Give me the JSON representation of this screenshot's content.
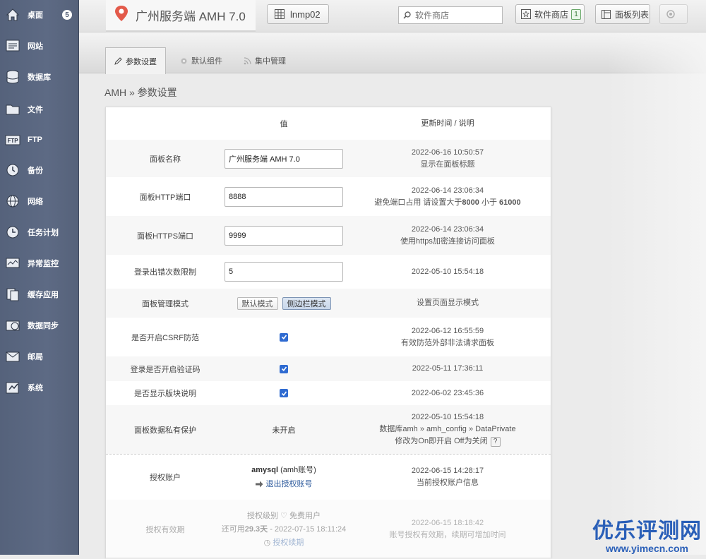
{
  "sidebar": {
    "items": [
      {
        "label": "桌面",
        "badge": "5",
        "icon": "home-icon"
      },
      {
        "label": "网站",
        "icon": "website-icon"
      },
      {
        "label": "数据库",
        "icon": "database-icon"
      },
      {
        "label": "文件",
        "icon": "folder-icon"
      },
      {
        "label": "FTP",
        "icon": "ftp-icon"
      },
      {
        "label": "备份",
        "icon": "backup-icon"
      },
      {
        "label": "网络",
        "icon": "globe-icon"
      },
      {
        "label": "任务计划",
        "icon": "clock-icon"
      },
      {
        "label": "异常监控",
        "icon": "monitor-icon"
      },
      {
        "label": "缓存应用",
        "icon": "cache-icon"
      },
      {
        "label": "数据同步",
        "icon": "sync-icon"
      },
      {
        "label": "邮局",
        "icon": "mail-icon"
      },
      {
        "label": "系统",
        "icon": "system-icon"
      }
    ]
  },
  "header": {
    "title": "广州服务端 AMH 7.0",
    "env_label": "lnmp02",
    "search_placeholder": "软件商店",
    "store_label": "软件商店",
    "store_count": "1",
    "panel_list_label": "面板列表"
  },
  "tabs": [
    {
      "label": "参数设置",
      "active": true
    },
    {
      "label": "默认组件",
      "active": false
    },
    {
      "label": "集中管理",
      "active": false
    }
  ],
  "breadcrumb": "AMH » 参数设置",
  "table": {
    "headers": {
      "value": "值",
      "updated": "更新时间 / 说明"
    },
    "rows": {
      "panel_name": {
        "label": "面板名称",
        "value": "广州服务端 AMH 7.0",
        "time": "2022-06-16 10:50:57",
        "note": "显示在面板标题"
      },
      "http_port": {
        "label": "面板HTTP端口",
        "value": "8888",
        "time": "2022-06-14 23:06:34",
        "note_pre": "避免端口占用 请设置大于",
        "note_min": "8000",
        "note_mid": " 小于",
        "note_max": "61000"
      },
      "https_port": {
        "label": "面板HTTPS端口",
        "value": "9999",
        "time": "2022-06-14 23:06:34",
        "note": "使用https加密连接访问面板"
      },
      "login_limit": {
        "label": "登录出错次数限制",
        "value": "5",
        "time": "2022-05-10 15:54:18"
      },
      "panel_mode": {
        "label": "面板管理模式",
        "btn_default": "默认模式",
        "btn_sidebar": "侧边栏模式",
        "note": "设置页面显示模式"
      },
      "csrf": {
        "label": "是否开启CSRF防范",
        "checked": true,
        "time": "2022-06-12 16:55:59",
        "note": "有效防范外部非法请求面板"
      },
      "captcha": {
        "label": "登录是否开启验证码",
        "checked": true,
        "time": "2022-05-11 17:36:11"
      },
      "block_desc": {
        "label": "是否显示版块说明",
        "checked": true,
        "time": "2022-06-02 23:45:36"
      },
      "private": {
        "label": "面板数据私有保护",
        "value": "未开启",
        "time": "2022-05-10 15:54:18",
        "note1": "数据库amh » amh_config » DataPrivate",
        "note2": "修改为On即开启 Off为关闭",
        "help": "?"
      },
      "auth_account": {
        "label": "授权账户",
        "user": "amysql",
        "user_note": "(amh账号)",
        "logout": "退出授权账号",
        "time": "2022-06-15 14:28:17",
        "note": "当前授权账户信息"
      },
      "auth_valid": {
        "label": "授权有效期",
        "level_label": "授权级别",
        "level_value": "免费用户",
        "remaining_pre": "还可用",
        "remaining_days": "29.3天",
        "remaining_range": " - 2022-07-15 18:11:24",
        "renew": "授权续期",
        "time": "2022-06-15 18:18:42",
        "note": "账号授权有效期，续期可增加时间"
      }
    }
  },
  "watermark": {
    "title": "优乐评测网",
    "url": "www.yimecn.com"
  },
  "colors": {
    "sidebar": "#5d6a84",
    "accent": "#2f6bd1",
    "brand_pin": "#e35a4a"
  }
}
